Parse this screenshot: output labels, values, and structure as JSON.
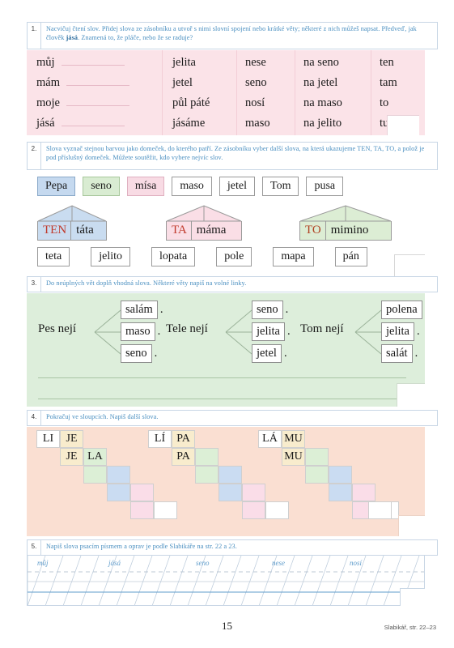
{
  "page": {
    "number": "15",
    "source_note": "Slabikář, str. 22–23"
  },
  "exercises": [
    {
      "number": "1.",
      "instruction_line1": "Nacvičuj čtení slov. Přidej slova ze zásobníku a utvoř s nimi slovní spojení nebo krátké věty; některé",
      "instruction_line2_pre": "z nich můžeš napsat. Předveď, jak člověk ",
      "instruction_bold": "jásá",
      "instruction_line2_post": ". Znamená to, že pláče, nebo že se raduje?",
      "columns": [
        {
          "words": [
            "můj",
            "mám",
            "moje",
            "jásá"
          ],
          "has_blank": true
        },
        {
          "words": [
            "jelita",
            "jetel",
            "půl páté",
            "jásáme"
          ],
          "has_blank": false
        },
        {
          "words": [
            "nese",
            "seno",
            "nosí",
            "maso"
          ],
          "has_blank": false
        },
        {
          "words": [
            "na seno",
            "na jetel",
            "na maso",
            "na jelito"
          ],
          "has_blank": false
        },
        {
          "words": [
            "ten",
            "tam",
            "to",
            "tu"
          ],
          "has_blank": false
        }
      ]
    },
    {
      "number": "2.",
      "instruction_line1": "Slova vyznač stejnou barvou jako domeček, do kterého patří. Ze zásobníku vyber další slova, na která",
      "instruction_line2": "ukazujeme TEN, TA, TO, a polož je pod příslušný domeček. Můžete soutěžit, kdo vybere nejvíc slov.",
      "word_bank_top": [
        {
          "label": "Pepa",
          "fill": "blue"
        },
        {
          "label": "seno",
          "fill": "green"
        },
        {
          "label": "mísa",
          "fill": "pink"
        },
        {
          "label": "maso",
          "fill": "white"
        },
        {
          "label": "jetel",
          "fill": "white"
        },
        {
          "label": "Tom",
          "fill": "white"
        },
        {
          "label": "pusa",
          "fill": "white"
        }
      ],
      "houses": [
        {
          "key": "TEN",
          "word": "táta",
          "fill": "blue",
          "key_color": "#c0392b"
        },
        {
          "key": "TA",
          "word": "máma",
          "fill": "pink",
          "key_color": "#c0392b"
        },
        {
          "key": "TO",
          "word": "mimino",
          "fill": "green",
          "key_color": "#b04020"
        }
      ],
      "word_bank_bottom": [
        {
          "label": "teta"
        },
        {
          "label": "jelito"
        },
        {
          "label": "lopata"
        },
        {
          "label": "pole"
        },
        {
          "label": "mapa"
        },
        {
          "label": "pán"
        }
      ]
    },
    {
      "number": "3.",
      "instruction_line1": "Do neúplných vět doplň vhodná slova. Některé věty napiš na volné linky.",
      "groups": [
        {
          "lead": "Pes nejí",
          "options": [
            "salám",
            "maso",
            "seno"
          ],
          "punct": "."
        },
        {
          "lead": "Tele nejí",
          "options": [
            "seno",
            "jelita",
            "jetel"
          ],
          "punct": "."
        },
        {
          "lead": "Tom nejí",
          "options": [
            "polena",
            "jelita",
            "salát"
          ],
          "punct": "."
        }
      ],
      "blank_lines": 2
    },
    {
      "number": "4.",
      "instruction_line1": "Pokračuj ve sloupcích. Napiš další slova.",
      "stairs": [
        {
          "row1": [
            "LI",
            "JE"
          ],
          "row2": [
            "JE",
            "LA"
          ]
        },
        {
          "row1": [
            "LÍ",
            "PA"
          ],
          "row2": [
            "PA",
            ""
          ]
        },
        {
          "row1": [
            "LÁ",
            "MU"
          ],
          "row2": [
            "MU",
            ""
          ]
        }
      ],
      "row_colors": [
        [
          "w",
          "cr"
        ],
        [
          "cr",
          "gr"
        ],
        [
          "gr",
          "bl"
        ],
        [
          "bl",
          "pk"
        ],
        [
          "pk",
          "w"
        ]
      ]
    },
    {
      "number": "5.",
      "instruction_line1": "Napiš slova psacím písmem a oprav je podle Slabikáře na str. 22 a 23.",
      "model_words": [
        "můj",
        "jásá",
        "seno",
        "nese",
        "nosí"
      ]
    }
  ],
  "colors": {
    "instruction_text": "#4a8fc0",
    "ex1_bg": "#fbe3e8",
    "ex3_bg": "#ddeedb",
    "ex4_bg": "#fadfd2",
    "house_blue": "#c9dcf0",
    "house_pink": "#fadee6",
    "house_green": "#dcedd4"
  }
}
